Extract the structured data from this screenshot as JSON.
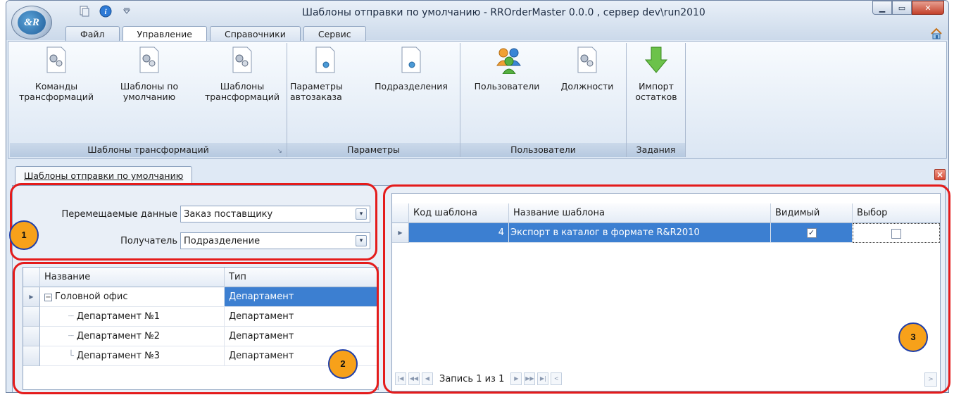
{
  "window": {
    "title": "Шаблоны  отправки по умолчанию - RROrderMaster 0.0.0 , сервер dev\\run2010",
    "logo_text": "&R"
  },
  "ribbon": {
    "tabs": [
      {
        "label": "Файл",
        "active": false
      },
      {
        "label": "Управление",
        "active": true
      },
      {
        "label": "Справочники",
        "active": false
      },
      {
        "label": "Сервис",
        "active": false
      }
    ],
    "groups": [
      {
        "label": "Шаблоны  трансформаций",
        "buttons": [
          {
            "label": "Команды трансформаций",
            "icon": "gear-document-icon"
          },
          {
            "label": "Шаблоны по умолчанию",
            "icon": "gear-document-icon"
          },
          {
            "label": "Шаблоны трансформаций",
            "icon": "gear-document-icon"
          }
        ]
      },
      {
        "label": "Параметры",
        "buttons": [
          {
            "label": "Параметры автозаказа",
            "icon": "document-icon"
          },
          {
            "label": "Подразделения",
            "icon": "document-icon"
          }
        ]
      },
      {
        "label": "Пользователи",
        "buttons": [
          {
            "label": "Пользователи",
            "icon": "users-icon"
          },
          {
            "label": "Должности",
            "icon": "gear-document-icon"
          }
        ]
      },
      {
        "label": "Задания",
        "buttons": [
          {
            "label": "Импорт остатков",
            "icon": "download-arrow-icon"
          }
        ]
      }
    ]
  },
  "document_tab": {
    "label": "Шаблоны  отправки по умолчанию"
  },
  "filters": {
    "data_label": "Перемещаемые данные",
    "data_value": "Заказ поставщику",
    "receiver_label": "Получатель",
    "receiver_value": "Подразделение"
  },
  "tree_grid": {
    "columns": [
      "Название",
      "Тип"
    ],
    "rows": [
      {
        "name": "Головной офис",
        "type": "Департамент",
        "selected": true
      },
      {
        "name": "Департамент №1",
        "type": "Департамент",
        "selected": false
      },
      {
        "name": "Департамент №2",
        "type": "Департамент",
        "selected": false
      },
      {
        "name": "Департамент №3",
        "type": "Департамент",
        "selected": false
      }
    ]
  },
  "templates_grid": {
    "columns": [
      "Код шаблона",
      "Название шаблона",
      "Видимый",
      "Выбор"
    ],
    "rows": [
      {
        "code": "4",
        "name": "Экспорт в каталог в формате  R&R2010",
        "visible": true,
        "selected": false
      }
    ],
    "navigator": "Запись 1 из 1"
  },
  "annotations": [
    "1",
    "2",
    "3"
  ],
  "colors": {
    "selection": "#3c7fd1",
    "annotation_frame": "#e41b1b",
    "badge_fill": "#f7a11a"
  }
}
